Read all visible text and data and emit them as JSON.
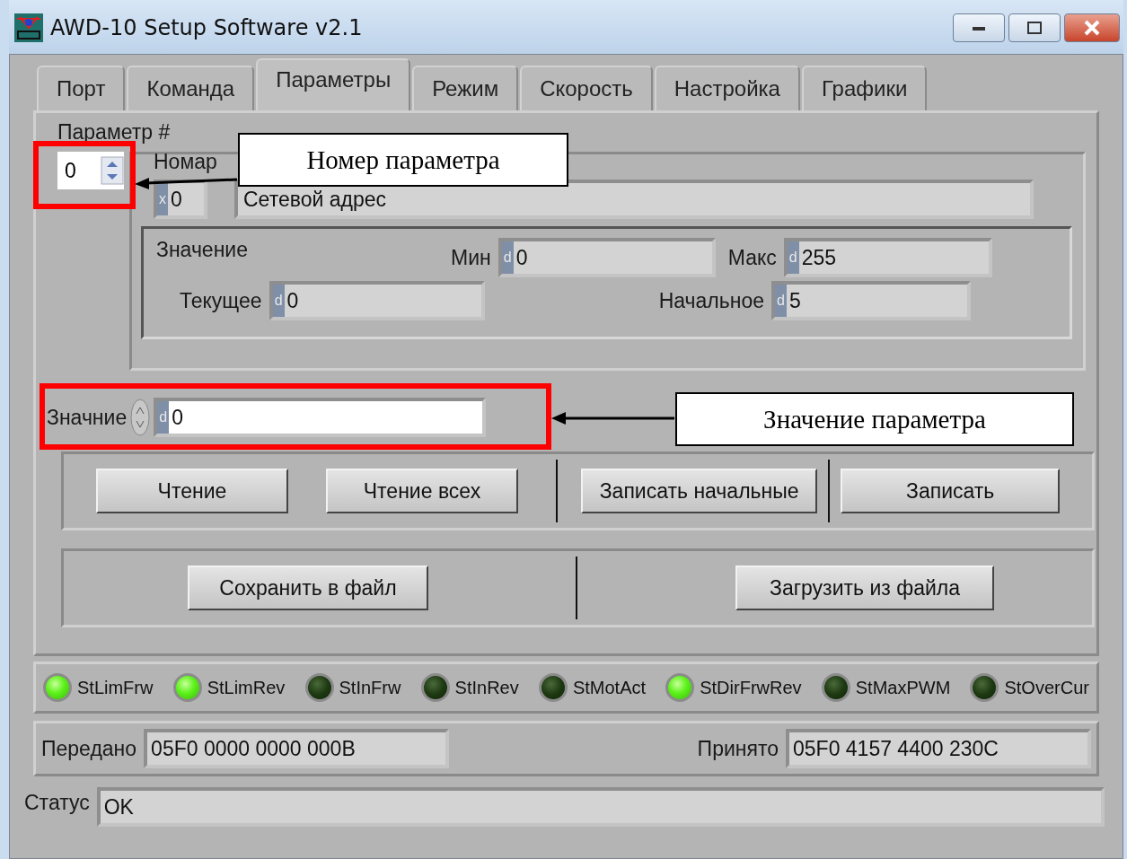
{
  "window": {
    "title": "AWD-10 Setup Software v2.1"
  },
  "tabs": [
    {
      "label": "Порт",
      "selected": false
    },
    {
      "label": "Команда",
      "selected": false
    },
    {
      "label": "Параметры",
      "selected": true
    },
    {
      "label": "Режим",
      "selected": false
    },
    {
      "label": "Скорость",
      "selected": false
    },
    {
      "label": "Настройка",
      "selected": false
    },
    {
      "label": "Графики",
      "selected": false
    }
  ],
  "parameter": {
    "label": "Параметр #",
    "number": "0"
  },
  "group": {
    "label": "Номар",
    "code_radix": "x",
    "code": "0",
    "name": "Сетевой адрес",
    "value_box": {
      "label": "Значение",
      "fields": [
        {
          "label": "Мин",
          "radix": "d",
          "value": "0"
        },
        {
          "label": "Макс",
          "radix": "d",
          "value": "255"
        },
        {
          "label": "Текущее",
          "radix": "d",
          "value": "0"
        },
        {
          "label": "Начальное",
          "radix": "d",
          "value": "5"
        }
      ]
    }
  },
  "value_input": {
    "label": "Значние",
    "radix": "d",
    "value": "0"
  },
  "buttons": [
    "Чтение",
    "Чтение всех",
    "Записать начальные",
    "Записать"
  ],
  "file_buttons": [
    "Сохранить в файл",
    "Загрузить из файла"
  ],
  "indicators": [
    {
      "label": "StLimFrw",
      "on": true
    },
    {
      "label": "StLimRev",
      "on": true
    },
    {
      "label": "StInFrw",
      "on": false
    },
    {
      "label": "StInRev",
      "on": false
    },
    {
      "label": "StMotAct",
      "on": false
    },
    {
      "label": "StDirFrwRev",
      "on": true
    },
    {
      "label": "StMaxPWM",
      "on": false
    },
    {
      "label": "StOverCur",
      "on": false
    }
  ],
  "transfer": {
    "sent_label": "Передано",
    "sent": "05F0 0000 0000 000B",
    "received_label": "Принято",
    "received": "05F0 4157 4400 230C"
  },
  "status": {
    "label": "Статус",
    "value": "OK"
  },
  "callouts": [
    {
      "text": "Номер параметра"
    },
    {
      "text": "Значение параметра"
    }
  ]
}
